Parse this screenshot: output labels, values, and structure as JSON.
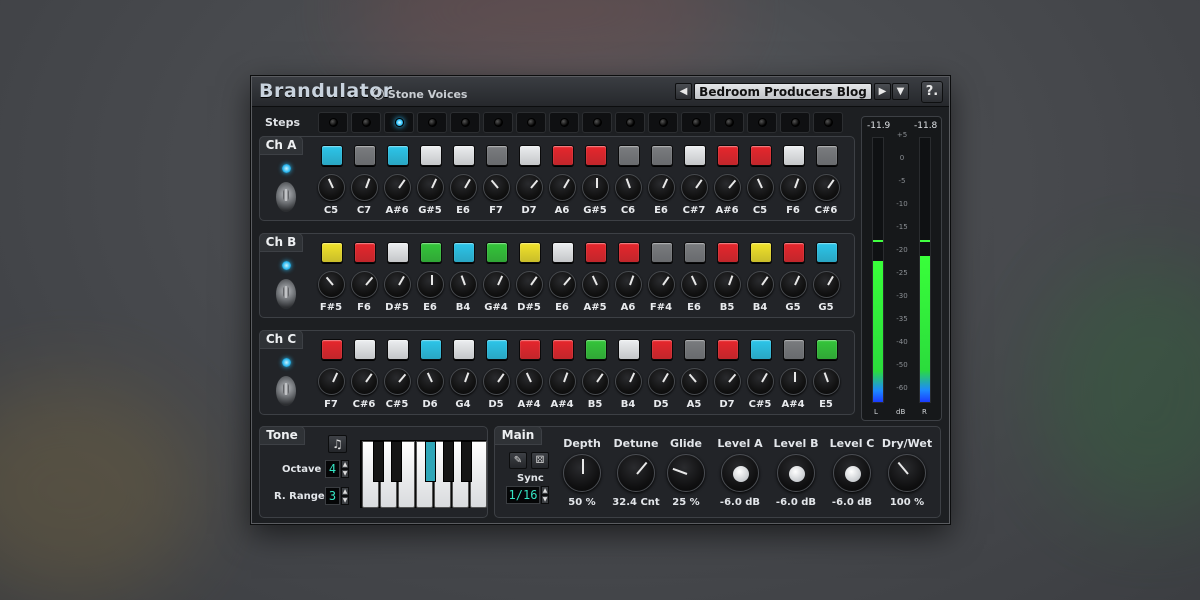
{
  "app": {
    "title": "Brandulator",
    "brand": "Stone Voices"
  },
  "preset": {
    "name": "Bedroom Producers Blog",
    "prev_icon": "arrow-left-icon",
    "next_icon": "arrow-right-icon",
    "menu_icon": "chevron-down-icon",
    "help_label": "?."
  },
  "steps": {
    "label": "Steps",
    "count": 16,
    "active_index": 2
  },
  "channels": [
    {
      "label": "Ch A",
      "pads": [
        "cyan",
        "gray",
        "cyan",
        "white",
        "white",
        "gray",
        "white",
        "red",
        "red",
        "gray",
        "gray",
        "white",
        "red",
        "red",
        "white",
        "gray"
      ],
      "notes": [
        "C5",
        "C7",
        "A#6",
        "G#5",
        "E6",
        "F7",
        "D7",
        "A6",
        "G#5",
        "C6",
        "E6",
        "C#7",
        "A#6",
        "C5",
        "F6",
        "C#6"
      ]
    },
    {
      "label": "Ch B",
      "pads": [
        "yellow",
        "red",
        "white",
        "green",
        "cyan",
        "green",
        "yellow",
        "white",
        "red",
        "red",
        "gray",
        "gray",
        "red",
        "yellow",
        "red",
        "cyan"
      ],
      "notes": [
        "F#5",
        "F6",
        "D#5",
        "E6",
        "B4",
        "G#4",
        "D#5",
        "E6",
        "A#5",
        "A6",
        "F#4",
        "E6",
        "B5",
        "B4",
        "G5",
        "G5"
      ]
    },
    {
      "label": "Ch C",
      "pads": [
        "red",
        "white",
        "white",
        "cyan",
        "white",
        "cyan",
        "red",
        "red",
        "green",
        "white",
        "red",
        "gray",
        "red",
        "cyan",
        "gray",
        "green"
      ],
      "notes": [
        "F7",
        "C#6",
        "C#5",
        "D6",
        "G4",
        "D5",
        "A#4",
        "A#4",
        "B5",
        "B4",
        "D5",
        "A5",
        "D7",
        "C#5",
        "A#4",
        "E5"
      ]
    }
  ],
  "colors": {
    "cyan": "#2cc6ea",
    "gray": "#7a7c7f",
    "white": "#eceef0",
    "red": "#e8262c",
    "yellow": "#f2e32a",
    "green": "#34c63a"
  },
  "meter": {
    "left_peak": "-11.9",
    "right_peak": "-11.8",
    "left_level": 0.53,
    "right_level": 0.55,
    "peak_hold": 0.6,
    "scale": [
      "+5",
      "0",
      "-5",
      "-10",
      "-15",
      "-20",
      "-25",
      "-30",
      "-35",
      "-40",
      "-50",
      "-60"
    ],
    "scale_bottom": "-60",
    "l_label": "L",
    "db_label": "dB",
    "r_label": "R"
  },
  "tone": {
    "label": "Tone",
    "octave_label": "Octave",
    "octave_value": "4",
    "range_label": "R. Range",
    "range_value": "3",
    "note_icon": "music-note-icon"
  },
  "main": {
    "label": "Main",
    "sync_label": "Sync",
    "sync_value": "1/16",
    "wrench_icon": "wrench-icon",
    "dice_icon": "dice-icon",
    "knobs": [
      {
        "label": "Depth",
        "value": "50 %"
      },
      {
        "label": "Detune",
        "value": "32.4 Cnt"
      },
      {
        "label": "Glide",
        "value": "25 %"
      },
      {
        "label": "Level A",
        "value": "-6.0 dB"
      },
      {
        "label": "Level B",
        "value": "-6.0 dB"
      },
      {
        "label": "Level C",
        "value": "-6.0 dB"
      },
      {
        "label": "Dry/Wet",
        "value": "100 %"
      }
    ]
  }
}
